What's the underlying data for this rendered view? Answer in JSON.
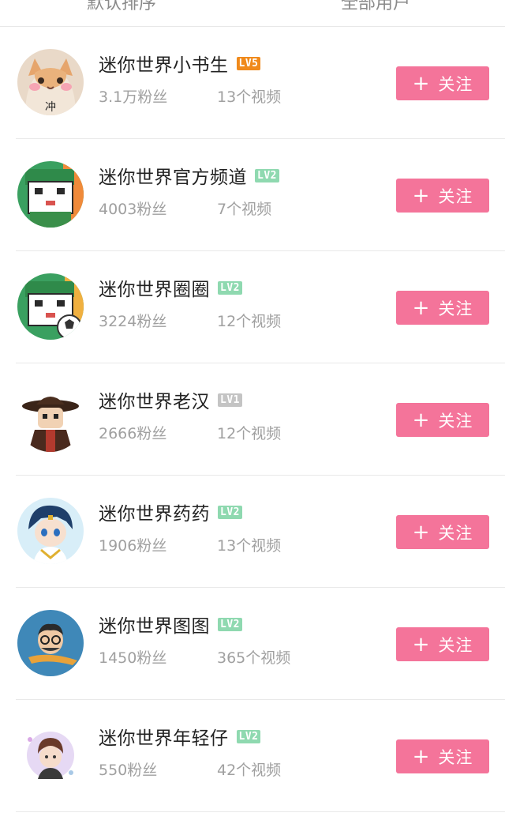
{
  "top_bar": {
    "sort_default": "默认排序",
    "filter_all": "全部用户"
  },
  "follow_label": "关注",
  "users": [
    {
      "name": "迷你世界小书生",
      "level": "LV5",
      "level_color": "#f08a1c",
      "fans": "3.1万粉丝",
      "videos": "13个视频",
      "avatar_char": "冲"
    },
    {
      "name": "迷你世界官方频道",
      "level": "LV2",
      "level_color": "#8fd9b0",
      "fans": "4003粉丝",
      "videos": "7个视频"
    },
    {
      "name": "迷你世界圈圈",
      "level": "LV2",
      "level_color": "#8fd9b0",
      "fans": "3224粉丝",
      "videos": "12个视频"
    },
    {
      "name": "迷你世界老汉",
      "level": "LV1",
      "level_color": "#c4c4c4",
      "fans": "2666粉丝",
      "videos": "12个视频"
    },
    {
      "name": "迷你世界药药",
      "level": "LV2",
      "level_color": "#8fd9b0",
      "fans": "1906粉丝",
      "videos": "13个视频"
    },
    {
      "name": "迷你世界图图",
      "level": "LV2",
      "level_color": "#8fd9b0",
      "fans": "1450粉丝",
      "videos": "365个视频"
    },
    {
      "name": "迷你世界年轻仔",
      "level": "LV2",
      "level_color": "#8fd9b0",
      "fans": "550粉丝",
      "videos": "42个视频"
    }
  ]
}
